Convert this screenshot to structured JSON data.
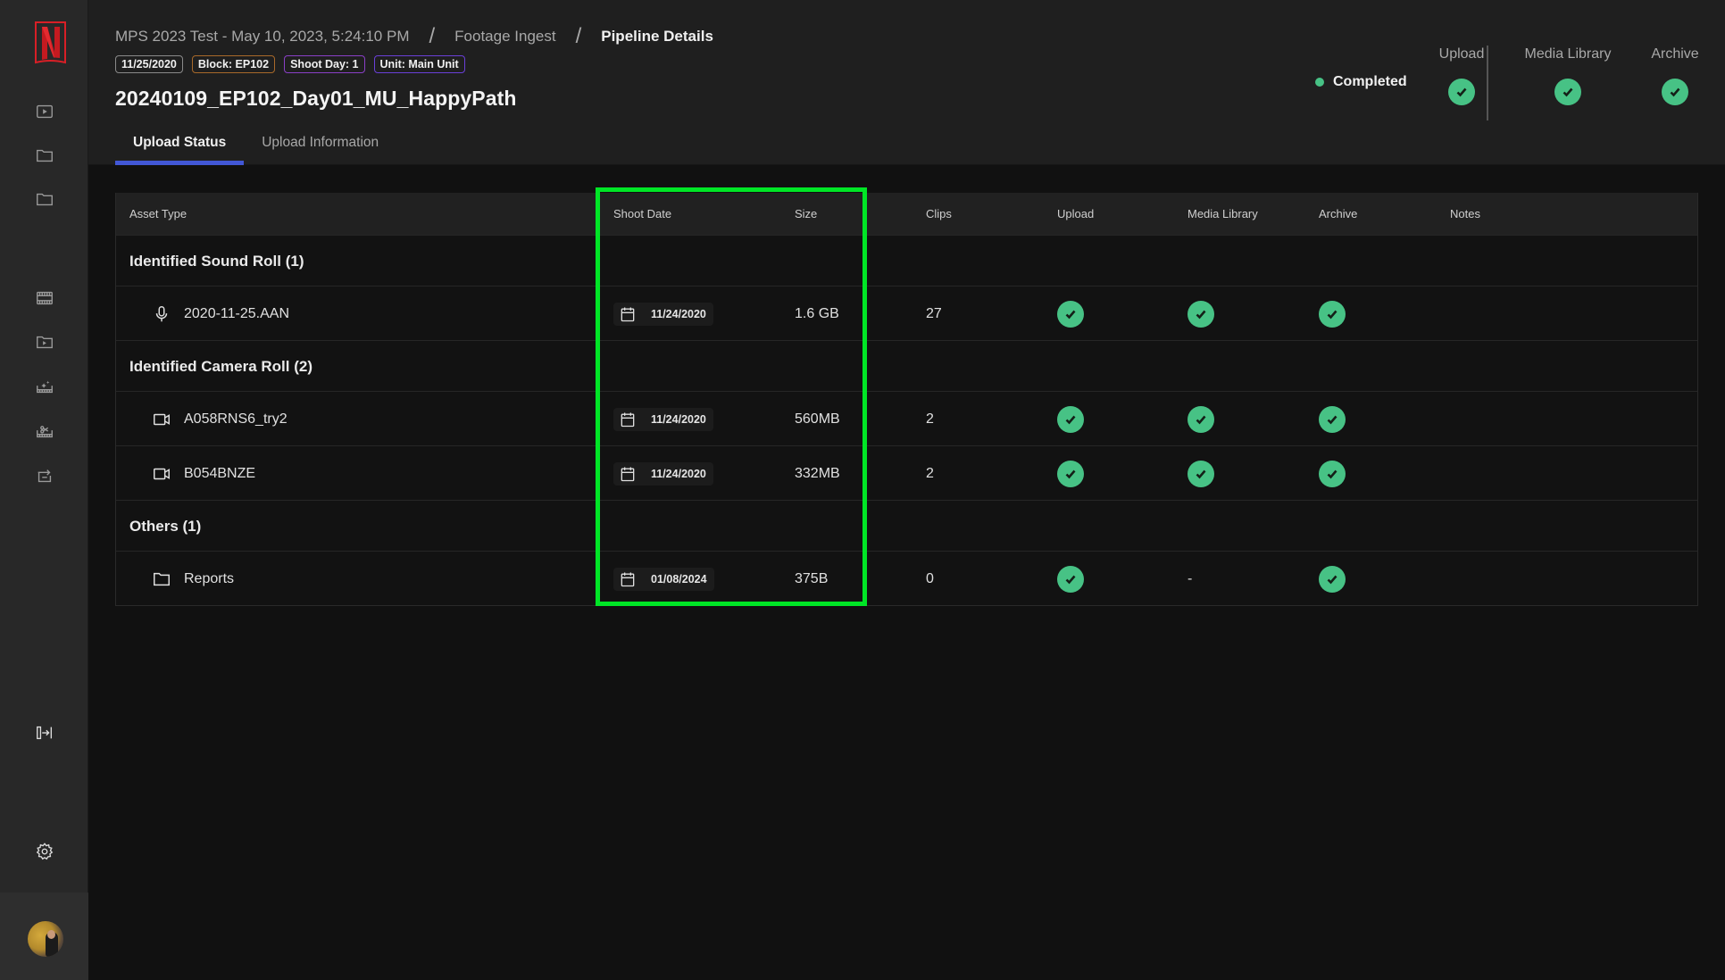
{
  "sidebar": {
    "logo": "netflix-n-logo",
    "top_icons": [
      {
        "name": "video-player-icon",
        "label": "Player"
      },
      {
        "name": "folder-icon",
        "label": "Folder"
      },
      {
        "name": "folder-icon",
        "label": "Folder"
      }
    ],
    "tool_icons": [
      {
        "name": "film-strip-icon"
      },
      {
        "name": "video-folder-icon"
      },
      {
        "name": "film-sparkle-icon"
      },
      {
        "name": "film-scissors-icon"
      },
      {
        "name": "transfer-box-icon"
      }
    ],
    "collapse_icon": "expand-sidebar-icon",
    "settings_icon": "gear-icon",
    "avatar": "user-avatar"
  },
  "header": {
    "breadcrumb": [
      {
        "label": "MPS 2023 Test - May 10, 2023, 5:24:10 PM"
      },
      {
        "label": "Footage Ingest"
      },
      {
        "label": "Pipeline Details"
      }
    ],
    "separator": "/",
    "badges": [
      {
        "label": "11/25/2020",
        "color": "#8a8a8a"
      },
      {
        "label": "Block: EP102",
        "color": "#a8692a"
      },
      {
        "label": "Shoot Day: 1",
        "color": "#8a3fc7"
      },
      {
        "label": "Unit: Main Unit",
        "color": "#6a3fd8"
      }
    ],
    "title": "20240109_EP102_Day01_MU_HappyPath",
    "tabs": [
      {
        "label": "Upload Status",
        "active": true
      },
      {
        "label": "Upload Information",
        "active": false
      }
    ],
    "status": {
      "label": "Completed",
      "color": "#47c285"
    },
    "summary": [
      {
        "label": "Upload",
        "state": "complete"
      },
      {
        "label": "Media Library",
        "state": "complete"
      },
      {
        "label": "Archive",
        "state": "complete"
      }
    ]
  },
  "table": {
    "columns": [
      "Asset Type",
      "Shoot Date",
      "Size",
      "Clips",
      "Upload",
      "Media Library",
      "Archive",
      "Notes"
    ],
    "groups": [
      {
        "label": "Identified Sound Roll (1)",
        "items": [
          {
            "icon": "microphone-icon",
            "name": "2020-11-25.AAN",
            "shoot_date": "11/24/2020",
            "size": "1.6 GB",
            "clips": "27",
            "upload": "complete",
            "media_library": "complete",
            "archive": "complete",
            "notes": ""
          }
        ]
      },
      {
        "label": "Identified Camera Roll (2)",
        "items": [
          {
            "icon": "video-camera-icon",
            "name": "A058RNS6_try2",
            "shoot_date": "11/24/2020",
            "size": "560MB",
            "clips": "2",
            "upload": "complete",
            "media_library": "complete",
            "archive": "complete",
            "notes": ""
          },
          {
            "icon": "video-camera-icon",
            "name": "B054BNZE",
            "shoot_date": "11/24/2020",
            "size": "332MB",
            "clips": "2",
            "upload": "complete",
            "media_library": "complete",
            "archive": "complete",
            "notes": ""
          }
        ]
      },
      {
        "label": "Others (1)",
        "items": [
          {
            "icon": "folder-icon",
            "name": "Reports",
            "shoot_date": "01/08/2024",
            "size": "375B",
            "clips": "0",
            "upload": "complete",
            "media_library": "-",
            "archive": "complete",
            "notes": ""
          }
        ]
      }
    ]
  },
  "highlight": {
    "color": "#00e626",
    "covers_columns": [
      "Shoot Date",
      "Size"
    ]
  }
}
